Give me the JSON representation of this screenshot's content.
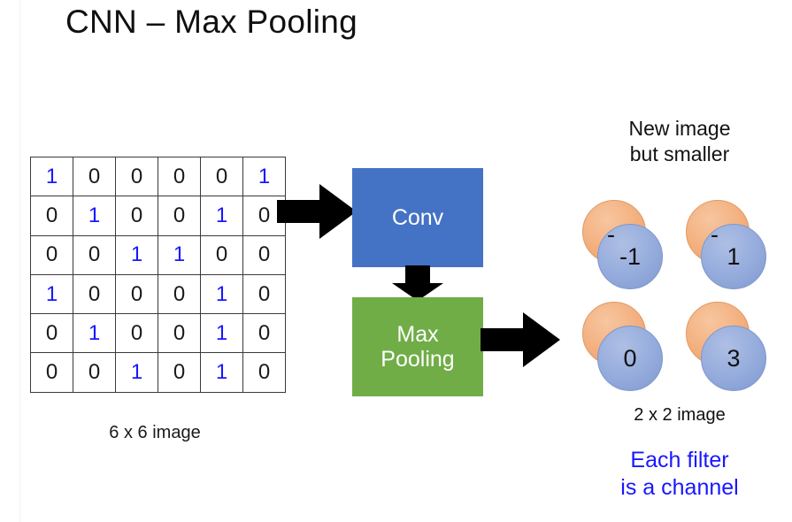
{
  "slide": {
    "title": "CNN – Max Pooling",
    "background_color": "#ffffff"
  },
  "input_matrix": {
    "caption": "6 x 6 image",
    "rows": [
      [
        "1",
        "0",
        "0",
        "0",
        "0",
        "1"
      ],
      [
        "0",
        "1",
        "0",
        "0",
        "1",
        "0"
      ],
      [
        "0",
        "0",
        "1",
        "1",
        "0",
        "0"
      ],
      [
        "1",
        "0",
        "0",
        "0",
        "1",
        "0"
      ],
      [
        "0",
        "1",
        "0",
        "0",
        "1",
        "0"
      ],
      [
        "0",
        "0",
        "1",
        "0",
        "1",
        "0"
      ]
    ],
    "highlight_value": "1",
    "highlight_color": "#1818ff",
    "normal_color": "#1a1a1a"
  },
  "pipeline": {
    "conv": {
      "label": "Conv",
      "color": "#4472c4"
    },
    "pooling": {
      "label": "Max\nPooling",
      "label_line1": "Max",
      "label_line2": "Pooling",
      "color": "#70ad47"
    },
    "arrows": {
      "input_to_conv": "arrow-right-icon",
      "conv_to_pooling": "arrow-down-icon",
      "pooling_to_output": "arrow-right-icon",
      "color": "#000000"
    }
  },
  "output": {
    "heading_line1": "New image",
    "heading_line2": "but smaller",
    "caption": "2 x 2 image",
    "note_line1": "Each filter",
    "note_line2": "is a channel",
    "note_color": "#1818ff",
    "front_circle_color": "#8faadc",
    "back_circle_color": "#f4b183",
    "cells": [
      {
        "value": "-1"
      },
      {
        "value": "1"
      },
      {
        "value": "0"
      },
      {
        "value": "3"
      }
    ]
  }
}
